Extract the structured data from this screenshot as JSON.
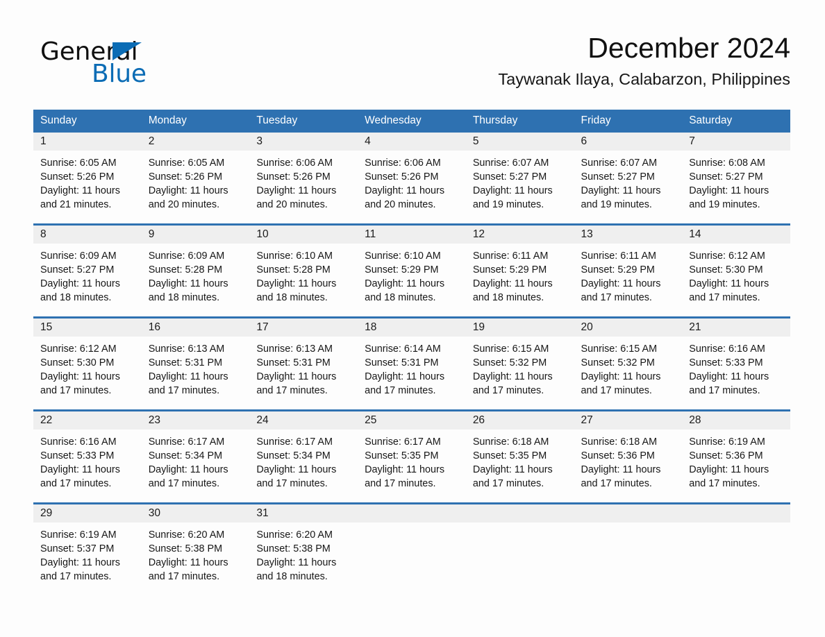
{
  "brand": {
    "name_dark": "General",
    "name_light": "Blue",
    "triangle_color": "#0b6cb5"
  },
  "header": {
    "title": "December 2024",
    "subtitle": "Taywanak Ilaya, Calabarzon, Philippines"
  },
  "theme": {
    "header_blue": "#2e71b1",
    "row_rule_blue": "#2e71b1",
    "daynum_band": "#efefef",
    "page_background": "#fdfdfd",
    "text": "#171717"
  },
  "calendar": {
    "weekday_headers": [
      "Sunday",
      "Monday",
      "Tuesday",
      "Wednesday",
      "Thursday",
      "Friday",
      "Saturday"
    ],
    "weeks": [
      [
        {
          "day": "1",
          "sunrise": "Sunrise: 6:05 AM",
          "sunset": "Sunset: 5:26 PM",
          "daylight_line1": "Daylight: 11 hours",
          "daylight_line2": "and 21 minutes."
        },
        {
          "day": "2",
          "sunrise": "Sunrise: 6:05 AM",
          "sunset": "Sunset: 5:26 PM",
          "daylight_line1": "Daylight: 11 hours",
          "daylight_line2": "and 20 minutes."
        },
        {
          "day": "3",
          "sunrise": "Sunrise: 6:06 AM",
          "sunset": "Sunset: 5:26 PM",
          "daylight_line1": "Daylight: 11 hours",
          "daylight_line2": "and 20 minutes."
        },
        {
          "day": "4",
          "sunrise": "Sunrise: 6:06 AM",
          "sunset": "Sunset: 5:26 PM",
          "daylight_line1": "Daylight: 11 hours",
          "daylight_line2": "and 20 minutes."
        },
        {
          "day": "5",
          "sunrise": "Sunrise: 6:07 AM",
          "sunset": "Sunset: 5:27 PM",
          "daylight_line1": "Daylight: 11 hours",
          "daylight_line2": "and 19 minutes."
        },
        {
          "day": "6",
          "sunrise": "Sunrise: 6:07 AM",
          "sunset": "Sunset: 5:27 PM",
          "daylight_line1": "Daylight: 11 hours",
          "daylight_line2": "and 19 minutes."
        },
        {
          "day": "7",
          "sunrise": "Sunrise: 6:08 AM",
          "sunset": "Sunset: 5:27 PM",
          "daylight_line1": "Daylight: 11 hours",
          "daylight_line2": "and 19 minutes."
        }
      ],
      [
        {
          "day": "8",
          "sunrise": "Sunrise: 6:09 AM",
          "sunset": "Sunset: 5:27 PM",
          "daylight_line1": "Daylight: 11 hours",
          "daylight_line2": "and 18 minutes."
        },
        {
          "day": "9",
          "sunrise": "Sunrise: 6:09 AM",
          "sunset": "Sunset: 5:28 PM",
          "daylight_line1": "Daylight: 11 hours",
          "daylight_line2": "and 18 minutes."
        },
        {
          "day": "10",
          "sunrise": "Sunrise: 6:10 AM",
          "sunset": "Sunset: 5:28 PM",
          "daylight_line1": "Daylight: 11 hours",
          "daylight_line2": "and 18 minutes."
        },
        {
          "day": "11",
          "sunrise": "Sunrise: 6:10 AM",
          "sunset": "Sunset: 5:29 PM",
          "daylight_line1": "Daylight: 11 hours",
          "daylight_line2": "and 18 minutes."
        },
        {
          "day": "12",
          "sunrise": "Sunrise: 6:11 AM",
          "sunset": "Sunset: 5:29 PM",
          "daylight_line1": "Daylight: 11 hours",
          "daylight_line2": "and 18 minutes."
        },
        {
          "day": "13",
          "sunrise": "Sunrise: 6:11 AM",
          "sunset": "Sunset: 5:29 PM",
          "daylight_line1": "Daylight: 11 hours",
          "daylight_line2": "and 17 minutes."
        },
        {
          "day": "14",
          "sunrise": "Sunrise: 6:12 AM",
          "sunset": "Sunset: 5:30 PM",
          "daylight_line1": "Daylight: 11 hours",
          "daylight_line2": "and 17 minutes."
        }
      ],
      [
        {
          "day": "15",
          "sunrise": "Sunrise: 6:12 AM",
          "sunset": "Sunset: 5:30 PM",
          "daylight_line1": "Daylight: 11 hours",
          "daylight_line2": "and 17 minutes."
        },
        {
          "day": "16",
          "sunrise": "Sunrise: 6:13 AM",
          "sunset": "Sunset: 5:31 PM",
          "daylight_line1": "Daylight: 11 hours",
          "daylight_line2": "and 17 minutes."
        },
        {
          "day": "17",
          "sunrise": "Sunrise: 6:13 AM",
          "sunset": "Sunset: 5:31 PM",
          "daylight_line1": "Daylight: 11 hours",
          "daylight_line2": "and 17 minutes."
        },
        {
          "day": "18",
          "sunrise": "Sunrise: 6:14 AM",
          "sunset": "Sunset: 5:31 PM",
          "daylight_line1": "Daylight: 11 hours",
          "daylight_line2": "and 17 minutes."
        },
        {
          "day": "19",
          "sunrise": "Sunrise: 6:15 AM",
          "sunset": "Sunset: 5:32 PM",
          "daylight_line1": "Daylight: 11 hours",
          "daylight_line2": "and 17 minutes."
        },
        {
          "day": "20",
          "sunrise": "Sunrise: 6:15 AM",
          "sunset": "Sunset: 5:32 PM",
          "daylight_line1": "Daylight: 11 hours",
          "daylight_line2": "and 17 minutes."
        },
        {
          "day": "21",
          "sunrise": "Sunrise: 6:16 AM",
          "sunset": "Sunset: 5:33 PM",
          "daylight_line1": "Daylight: 11 hours",
          "daylight_line2": "and 17 minutes."
        }
      ],
      [
        {
          "day": "22",
          "sunrise": "Sunrise: 6:16 AM",
          "sunset": "Sunset: 5:33 PM",
          "daylight_line1": "Daylight: 11 hours",
          "daylight_line2": "and 17 minutes."
        },
        {
          "day": "23",
          "sunrise": "Sunrise: 6:17 AM",
          "sunset": "Sunset: 5:34 PM",
          "daylight_line1": "Daylight: 11 hours",
          "daylight_line2": "and 17 minutes."
        },
        {
          "day": "24",
          "sunrise": "Sunrise: 6:17 AM",
          "sunset": "Sunset: 5:34 PM",
          "daylight_line1": "Daylight: 11 hours",
          "daylight_line2": "and 17 minutes."
        },
        {
          "day": "25",
          "sunrise": "Sunrise: 6:17 AM",
          "sunset": "Sunset: 5:35 PM",
          "daylight_line1": "Daylight: 11 hours",
          "daylight_line2": "and 17 minutes."
        },
        {
          "day": "26",
          "sunrise": "Sunrise: 6:18 AM",
          "sunset": "Sunset: 5:35 PM",
          "daylight_line1": "Daylight: 11 hours",
          "daylight_line2": "and 17 minutes."
        },
        {
          "day": "27",
          "sunrise": "Sunrise: 6:18 AM",
          "sunset": "Sunset: 5:36 PM",
          "daylight_line1": "Daylight: 11 hours",
          "daylight_line2": "and 17 minutes."
        },
        {
          "day": "28",
          "sunrise": "Sunrise: 6:19 AM",
          "sunset": "Sunset: 5:36 PM",
          "daylight_line1": "Daylight: 11 hours",
          "daylight_line2": "and 17 minutes."
        }
      ],
      [
        {
          "day": "29",
          "sunrise": "Sunrise: 6:19 AM",
          "sunset": "Sunset: 5:37 PM",
          "daylight_line1": "Daylight: 11 hours",
          "daylight_line2": "and 17 minutes."
        },
        {
          "day": "30",
          "sunrise": "Sunrise: 6:20 AM",
          "sunset": "Sunset: 5:38 PM",
          "daylight_line1": "Daylight: 11 hours",
          "daylight_line2": "and 17 minutes."
        },
        {
          "day": "31",
          "sunrise": "Sunrise: 6:20 AM",
          "sunset": "Sunset: 5:38 PM",
          "daylight_line1": "Daylight: 11 hours",
          "daylight_line2": "and 18 minutes."
        },
        {
          "day": "",
          "sunrise": "",
          "sunset": "",
          "daylight_line1": "",
          "daylight_line2": ""
        },
        {
          "day": "",
          "sunrise": "",
          "sunset": "",
          "daylight_line1": "",
          "daylight_line2": ""
        },
        {
          "day": "",
          "sunrise": "",
          "sunset": "",
          "daylight_line1": "",
          "daylight_line2": ""
        },
        {
          "day": "",
          "sunrise": "",
          "sunset": "",
          "daylight_line1": "",
          "daylight_line2": ""
        }
      ]
    ]
  }
}
